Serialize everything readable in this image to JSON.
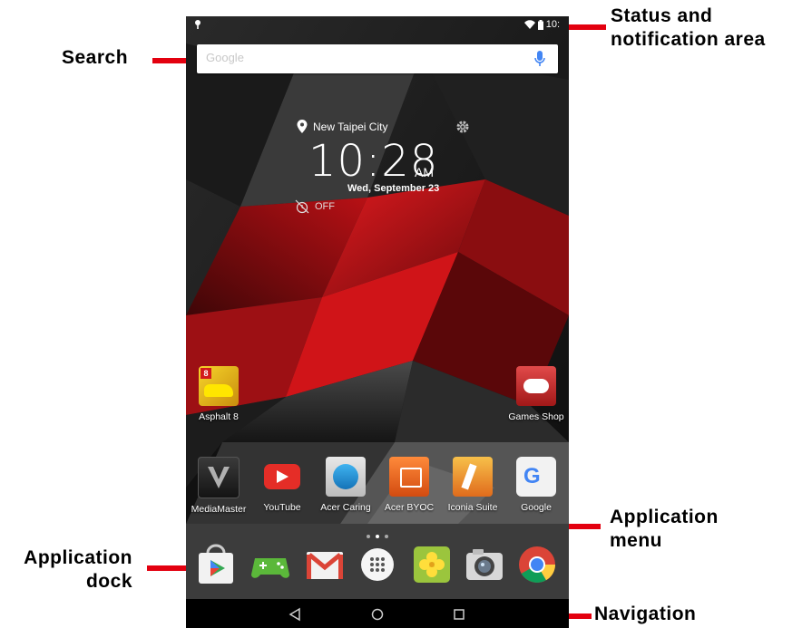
{
  "callouts": {
    "status": "Status and\nnotification area",
    "status_line1": "Status and",
    "status_line2": "notification area",
    "search": "Search",
    "app_menu_line1": "Application",
    "app_menu_line2": "menu",
    "app_dock_line1": "Application",
    "app_dock_line2": "dock",
    "navigation": "Navigation"
  },
  "status_bar": {
    "time": "10:"
  },
  "search": {
    "logo": "Google"
  },
  "clock": {
    "location": "New Taipei City",
    "time": "10:28",
    "ampm": "AM",
    "date": "Wed, September 23",
    "alarm": "OFF"
  },
  "home_apps": [
    {
      "label": "Asphalt 8"
    },
    {
      "label": "Games Shop"
    }
  ],
  "shortcut_row": [
    {
      "label": "MediaMaster"
    },
    {
      "label": "YouTube"
    },
    {
      "label": "Acer Caring"
    },
    {
      "label": "Acer BYOC"
    },
    {
      "label": "Iconia Suite"
    },
    {
      "label": "Google"
    }
  ],
  "colors": {
    "callout_red": "#e3000f",
    "accent_red": "#c4121b"
  }
}
